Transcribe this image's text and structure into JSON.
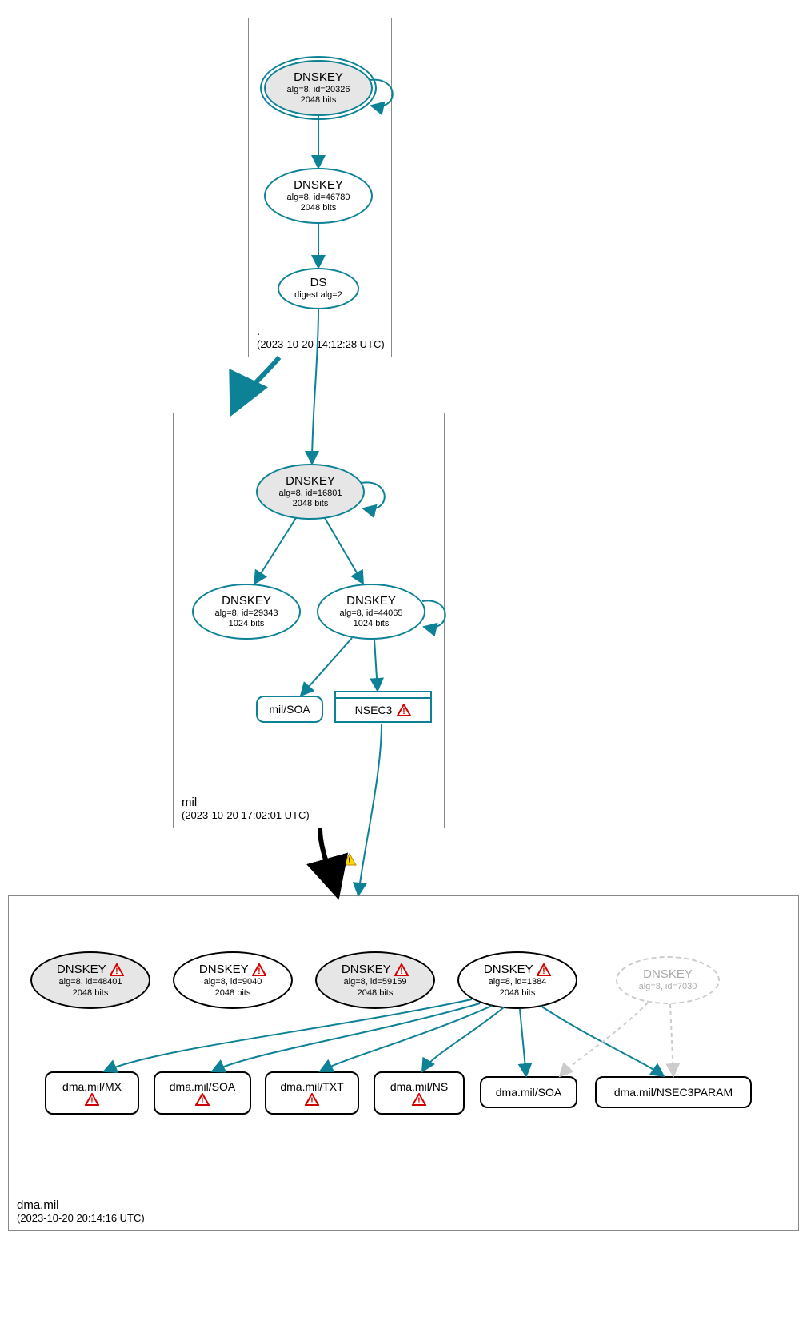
{
  "zones": {
    "root": {
      "name": ".",
      "timestamp": "(2023-10-20 14:12:28 UTC)",
      "nodes": {
        "k1": {
          "title": "DNSKEY",
          "line2": "alg=8, id=20326",
          "line3": "2048 bits"
        },
        "k2": {
          "title": "DNSKEY",
          "line2": "alg=8, id=46780",
          "line3": "2048 bits"
        },
        "ds": {
          "title": "DS",
          "line2": "digest alg=2"
        }
      }
    },
    "mil": {
      "name": "mil",
      "timestamp": "(2023-10-20 17:02:01 UTC)",
      "nodes": {
        "k1": {
          "title": "DNSKEY",
          "line2": "alg=8, id=16801",
          "line3": "2048 bits"
        },
        "k2": {
          "title": "DNSKEY",
          "line2": "alg=8, id=29343",
          "line3": "1024 bits"
        },
        "k3": {
          "title": "DNSKEY",
          "line2": "alg=8, id=44065",
          "line3": "1024 bits"
        },
        "soa": {
          "label": "mil/SOA"
        },
        "nsec3": {
          "label": "NSEC3"
        }
      }
    },
    "dma": {
      "name": "dma.mil",
      "timestamp": "(2023-10-20 20:14:16 UTC)",
      "nodes": {
        "k1": {
          "title": "DNSKEY",
          "line2": "alg=8, id=48401",
          "line3": "2048 bits"
        },
        "k2": {
          "title": "DNSKEY",
          "line2": "alg=8, id=9040",
          "line3": "2048 bits"
        },
        "k3": {
          "title": "DNSKEY",
          "line2": "alg=8, id=59159",
          "line3": "2048 bits"
        },
        "k4": {
          "title": "DNSKEY",
          "line2": "alg=8, id=1384",
          "line3": "2048 bits"
        },
        "k5": {
          "title": "DNSKEY",
          "line2": "alg=8, id=7030"
        },
        "rr1": {
          "label": "dma.mil/MX"
        },
        "rr2": {
          "label": "dma.mil/SOA"
        },
        "rr3": {
          "label": "dma.mil/TXT"
        },
        "rr4": {
          "label": "dma.mil/NS"
        },
        "rr5": {
          "label": "dma.mil/SOA"
        },
        "rr6": {
          "label": "dma.mil/NSEC3PARAM"
        }
      }
    }
  }
}
